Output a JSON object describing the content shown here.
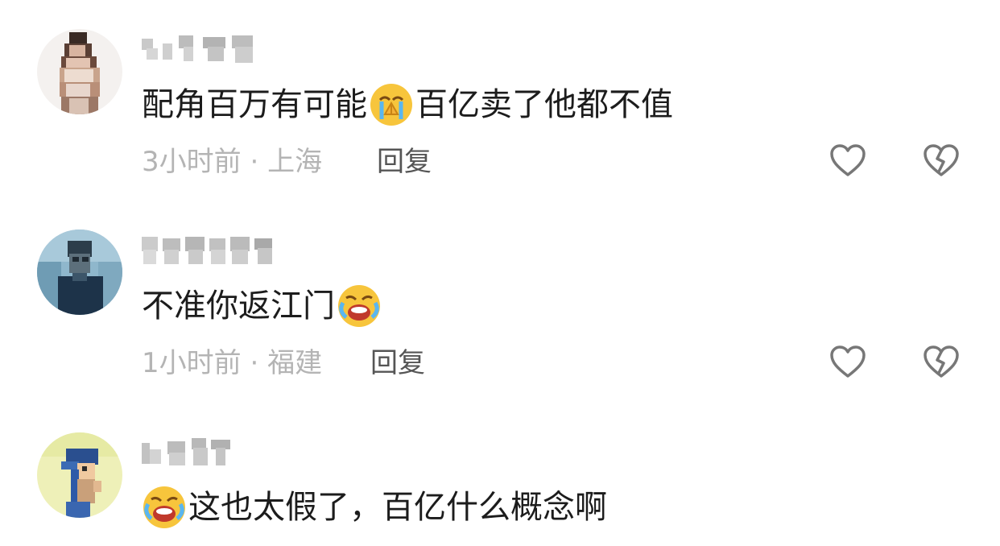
{
  "comments": [
    {
      "text_before": "配角百万有可能",
      "emoji_mid": "crying-pray-emoji",
      "text_after": "百亿卖了他都不值",
      "time": "3小时前",
      "location": "上海",
      "reply_label": "回复"
    },
    {
      "text_before": "不准你返江门",
      "emoji_end": "loudly-crying-emoji",
      "time": "1小时前",
      "location": "福建",
      "reply_label": "回复"
    },
    {
      "emoji_start": "loudly-crying-emoji",
      "text_after": "这也太假了，百亿什么概念啊"
    }
  ],
  "meta_separator": " · ",
  "icons": {
    "like": "heart-outline-icon",
    "dislike": "broken-heart-icon"
  },
  "colors": {
    "text": "#1c1c1c",
    "meta": "#b4b4b4",
    "reply": "#555555",
    "icon": "#777777"
  }
}
